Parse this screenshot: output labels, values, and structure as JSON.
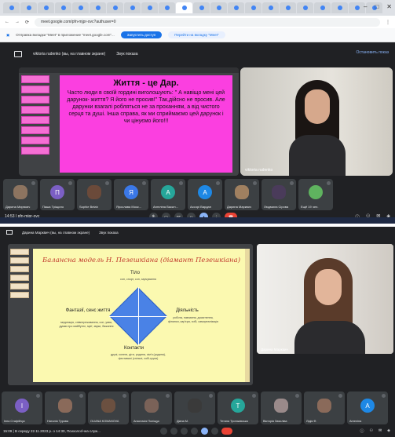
{
  "shot1": {
    "browser": {
      "tab_count": 22,
      "url": "meet.google.com/pfn-mjpr-ovc?authuser=0",
      "window_controls": [
        "–",
        "□",
        "✕"
      ]
    },
    "infobar": {
      "text": "Отправка вкладки \"Meet\" в приложение \"meet.google.com\"...",
      "primary_button": "Запустить доступ",
      "secondary_button": "Перейти на вкладку \"Meet\""
    },
    "meeting_header": {
      "presenter": "viktoria rudenko (вы, на главном экране)",
      "sound_label": "Звук показа",
      "stop_label": "Остановить показ"
    },
    "slide": {
      "title": "Життя - це Дар.",
      "body": "Часто люди в своїй гордині виголошують: \" А навіщо мені цей дарунок- життя? Я його не просив!\" Так,дійсно не просив. Але дарунки взагалі робляться не за проханням, а від чистого серця та душі. Інша справа, як ми сприймаємо цей дарунок і чи цінуємо його!!!"
    },
    "camera": {
      "name": "viktoria rudenko"
    },
    "participants": [
      {
        "initial": "",
        "name": "Дарина Мирвоич",
        "color": "#8d7460",
        "photo": true
      },
      {
        "initial": "П",
        "name": "Паша Тріщило",
        "color": "#7b5fc4",
        "photo": false
      },
      {
        "initial": "",
        "name": "Sophie Belah",
        "color": "#6b4a3a",
        "photo": true
      },
      {
        "initial": "Я",
        "name": "Ярослава Моск...",
        "color": "#3b78e7",
        "photo": false
      },
      {
        "initial": "А",
        "name": "Ангеліна Васил...",
        "color": "#26a69a",
        "photo": false
      },
      {
        "initial": "А",
        "name": "Ассорі Вардан",
        "color": "#1e88e5",
        "photo": false
      },
      {
        "initial": "",
        "name": "Дарина Марквич",
        "color": "#a08060",
        "photo": true
      },
      {
        "initial": "",
        "name": "Людмила Сірова",
        "color": "#4a3b5a",
        "photo": true
      },
      {
        "initial": "",
        "name": "Ещё 19 чел.",
        "color": "#5fb35f",
        "photo": false
      }
    ],
    "controls": {
      "time": "14:53",
      "code": "pfn-mjpr-ovc",
      "buttons": [
        "mic",
        "camera",
        "captions",
        "raise-hand",
        "present",
        "more",
        "end-call"
      ],
      "right": [
        "info",
        "people",
        "chat",
        "activities"
      ]
    }
  },
  "shot2": {
    "meeting_header": {
      "presenter": "Дарина Марквич (вы, на главном экране)",
      "sound_label": "Звук показа"
    },
    "slide": {
      "title": "Балансна модель Н. Пезешкіана (діамант Пезешкіана)",
      "top_label": "Тіло",
      "top_text": "сон, спорт, сон, харчування",
      "left_label": "Фантазії, сенс життя",
      "left_text": "медитація, співпереживання, сон, уява, думки про майбутнє, мрії, звуки, бажання",
      "right_label": "Діяльність",
      "right_text": "робота, навчання, досягнення, фінанси, кар'єра, хобі, самореалізація",
      "bottom_label": "Контакти",
      "bottom_text": "друзі, колеги, діти, родина, сім'я (родина), фестивалі (спільні, хобі-групи)"
    },
    "camera": {
      "name": "Дарина Марквич"
    },
    "participants": [
      {
        "initial": "І",
        "name": "Інна Стафійчук",
        "color": "#7b5fc4",
        "photo": false
      },
      {
        "initial": "",
        "name": "Наталія Турова",
        "color": "#8a6a5a",
        "photo": true
      },
      {
        "initial": "",
        "name": "OLIANA KOMANOVA",
        "color": "#6b5040",
        "photo": true
      },
      {
        "initial": "",
        "name": "Анастасія Поліщук",
        "color": "#7a6258",
        "photo": true
      },
      {
        "initial": "",
        "name": "Діана М.",
        "color": "#3a3a3a",
        "photo": true
      },
      {
        "initial": "Т",
        "name": "Тетяна Троньківська",
        "color": "#26a69a",
        "photo": false
      },
      {
        "initial": "",
        "name": "Вікторія Заясліва",
        "color": "#9a8a8a",
        "photo": true
      },
      {
        "initial": "",
        "name": "Лідія Ф.",
        "color": "#8a6a5a",
        "photo": true
      },
      {
        "initial": "А",
        "name": "Ангеліна",
        "color": "#1e88e5",
        "photo": false
      }
    ],
    "controls": {
      "time": "15:09",
      "info": "В середу 22.11.2023 р. о 14:30, Психологічна служ..."
    }
  }
}
